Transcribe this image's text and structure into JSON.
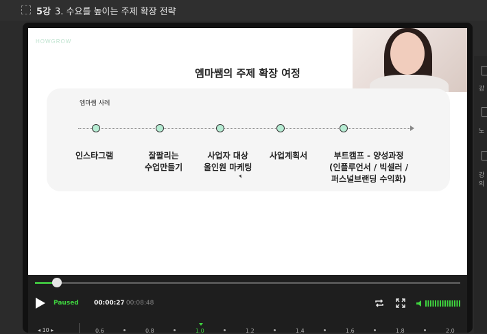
{
  "header": {
    "lesson": "5강",
    "title": "3. 수요를 높이는 주제 확장 전략"
  },
  "slide": {
    "brand": "HOWGROW",
    "title": "엠마쌤의 주제 확장 여정",
    "case_label": "엠마쌤 사례",
    "stages": [
      {
        "lines": [
          "인스타그램"
        ]
      },
      {
        "lines": [
          "잘팔리는",
          "수업만들기"
        ]
      },
      {
        "lines": [
          "사업자 대상",
          "올인원 마케팅"
        ]
      },
      {
        "lines": [
          "사업계획서"
        ]
      },
      {
        "lines": [
          "부트캠프 - 양성과정",
          "(인플루언서 / 빅셀러 /",
          "퍼스널브랜딩 수익화)"
        ]
      }
    ],
    "timeline_color": "#b6ecd3"
  },
  "player": {
    "status": "Paused",
    "current_time": "00:00:27",
    "total_time": "/ 00:08:48",
    "progress": 0.05,
    "accent": "#3fd43f",
    "speed_steps": "10",
    "speeds": [
      "0.6",
      "0.8",
      "1.0",
      "1.2",
      "1.4",
      "1.6",
      "1.8",
      "2.0"
    ],
    "active_speed": "1.0",
    "icons": {
      "play": "play-icon",
      "loop": "loop-icon",
      "fullscreen": "fullscreen-icon",
      "volume": "volume-icon"
    }
  },
  "sidebar": {
    "items": [
      "강",
      "노",
      "강의"
    ]
  }
}
